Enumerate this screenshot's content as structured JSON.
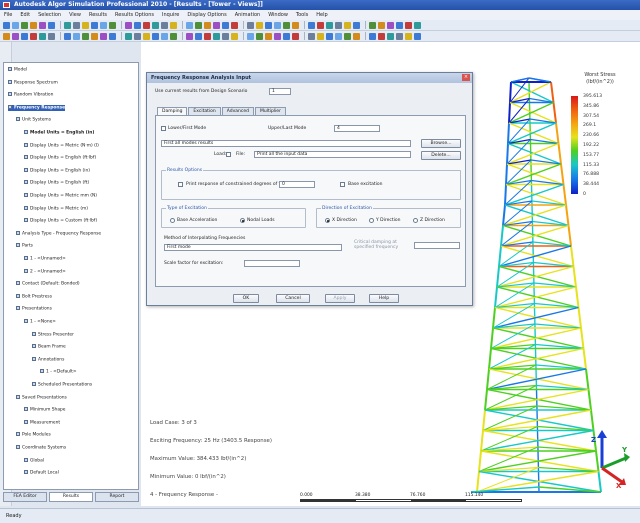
{
  "window": {
    "title": "Autodesk Algor Simulation Professional 2010 - [Results - [Tower - Views]]"
  },
  "menu": {
    "items": [
      "File",
      "Edit",
      "Selection",
      "View",
      "Results",
      "Results Options",
      "Inquire",
      "Display Options",
      "Animation",
      "Window",
      "Tools",
      "Help"
    ]
  },
  "tree": {
    "rows": [
      {
        "text": "Model",
        "bold": false,
        "indent": 0
      },
      {
        "text": "Response Spectrum",
        "bold": false,
        "indent": 0
      },
      {
        "text": "Random Vibration",
        "bold": false,
        "indent": 0
      },
      {
        "text": "Frequency Response",
        "bold": true,
        "indent": 0,
        "selected": true
      },
      {
        "text": "Unit Systems",
        "bold": false,
        "indent": 1
      },
      {
        "text": "Model Units = English (in)",
        "bold": true,
        "indent": 2
      },
      {
        "text": "Display Units = Metric (N·m) (I)",
        "bold": false,
        "indent": 2
      },
      {
        "text": "Display Units = English (ft·lbf)",
        "bold": false,
        "indent": 2
      },
      {
        "text": "Display Units = English (in)",
        "bold": false,
        "indent": 2
      },
      {
        "text": "Display Units = English (ft)",
        "bold": false,
        "indent": 2
      },
      {
        "text": "Display Units = Metric mm (N)",
        "bold": false,
        "indent": 2
      },
      {
        "text": "Display Units = Metric (m)",
        "bold": false,
        "indent": 2
      },
      {
        "text": "Display Units = Custom (ft·lbf)",
        "bold": false,
        "indent": 2
      },
      {
        "text": "Analysis Type - Frequency Response",
        "bold": false,
        "indent": 1
      },
      {
        "text": "Parts",
        "bold": false,
        "indent": 1
      },
      {
        "text": "1 - <Unnamed>",
        "bold": false,
        "indent": 2
      },
      {
        "text": "2 - <Unnamed>",
        "bold": false,
        "indent": 2
      },
      {
        "text": "Contact (Default: Bonded)",
        "bold": false,
        "indent": 1
      },
      {
        "text": "Bolt Prestress",
        "bold": false,
        "indent": 1
      },
      {
        "text": "Presentations",
        "bold": false,
        "indent": 1
      },
      {
        "text": "1 - <None>",
        "bold": false,
        "indent": 2
      },
      {
        "text": "Stress Presenter",
        "bold": false,
        "indent": 3
      },
      {
        "text": "Beam Frame",
        "bold": false,
        "indent": 3
      },
      {
        "text": "Annotations",
        "bold": false,
        "indent": 3
      },
      {
        "text": "1 - <Default>",
        "bold": false,
        "indent": 4
      },
      {
        "text": "Scheduled Presentations",
        "bold": false,
        "indent": 3
      },
      {
        "text": "Saved Presentations",
        "bold": false,
        "indent": 1
      },
      {
        "text": "Minimum Shape",
        "bold": false,
        "indent": 2
      },
      {
        "text": "Measurement",
        "bold": false,
        "indent": 2
      },
      {
        "text": "Pole Modules",
        "bold": false,
        "indent": 1
      },
      {
        "text": "Coordinate Systems",
        "bold": false,
        "indent": 1
      },
      {
        "text": "Global",
        "bold": false,
        "indent": 2
      },
      {
        "text": "Default Local",
        "bold": false,
        "indent": 2
      }
    ]
  },
  "tree_tabs": [
    "FEA Editor",
    "Results",
    "Report"
  ],
  "dialog": {
    "title": "Frequency Response Analysis Input",
    "load_label": "Use current results from Design Scenario",
    "load_value": "1",
    "tabs": [
      "Damping",
      "Excitation",
      "Advanced",
      "Multiplier"
    ],
    "lower_freq_label": "Lower/First Mode",
    "upper_freq_label": "Upper/Last Mode",
    "upper_freq_value": "4",
    "dropdown_value": "First all modes results",
    "browse_label": "Browse...",
    "load_checkbox_label": "Load:",
    "file_label": "File:",
    "file_value": "Print all the input data",
    "delete_label": "Delete...",
    "group1_title": "Results Options",
    "group1_opt1": "Print response of constrained degrees of freedom",
    "group1_opt1_value": "0",
    "group1_opt2": "Base excitation",
    "group2_title": "Type of Excitation",
    "group2_opt1": "Base Acceleration",
    "group2_opt2": "Nodal Loads",
    "group3_title": "Direction of Excitation",
    "group3_opt1": "X Direction",
    "group3_opt2": "Y Direction",
    "group3_opt3": "Z Direction",
    "sweep_label": "Method of Interpolating Frequencies",
    "sweep_value": "First mode",
    "critical_damp_label": "Critical damping at specified frequency",
    "scale_label": "Scale factor for excitation:",
    "scale_value": "",
    "buttons": {
      "ok": "OK",
      "cancel": "Cancel",
      "apply": "Apply",
      "help": "Help"
    }
  },
  "legend": {
    "title": "Worst Stress",
    "units": "(lbf/(in^2))",
    "ticks": [
      "395.613",
      "345.86",
      "307.54",
      "269.1",
      "230.66",
      "192.22",
      "153.77",
      "115.33",
      "76.888",
      "38.444",
      "0"
    ]
  },
  "info": {
    "load_case": "Load Case:  3 of 3",
    "excite": "Exciting Frequency: 25 Hz (3403.5 Response)",
    "max": "Maximum Value: 384.433 lbf/(in^2)",
    "min": "Minimum Value: 0 lbf/(in^2)",
    "preset": "4 - Frequency Response -"
  },
  "scale": {
    "labels": [
      "0.000",
      "38.380",
      "76.760",
      "115.140"
    ]
  },
  "status": {
    "text": "Ready"
  }
}
